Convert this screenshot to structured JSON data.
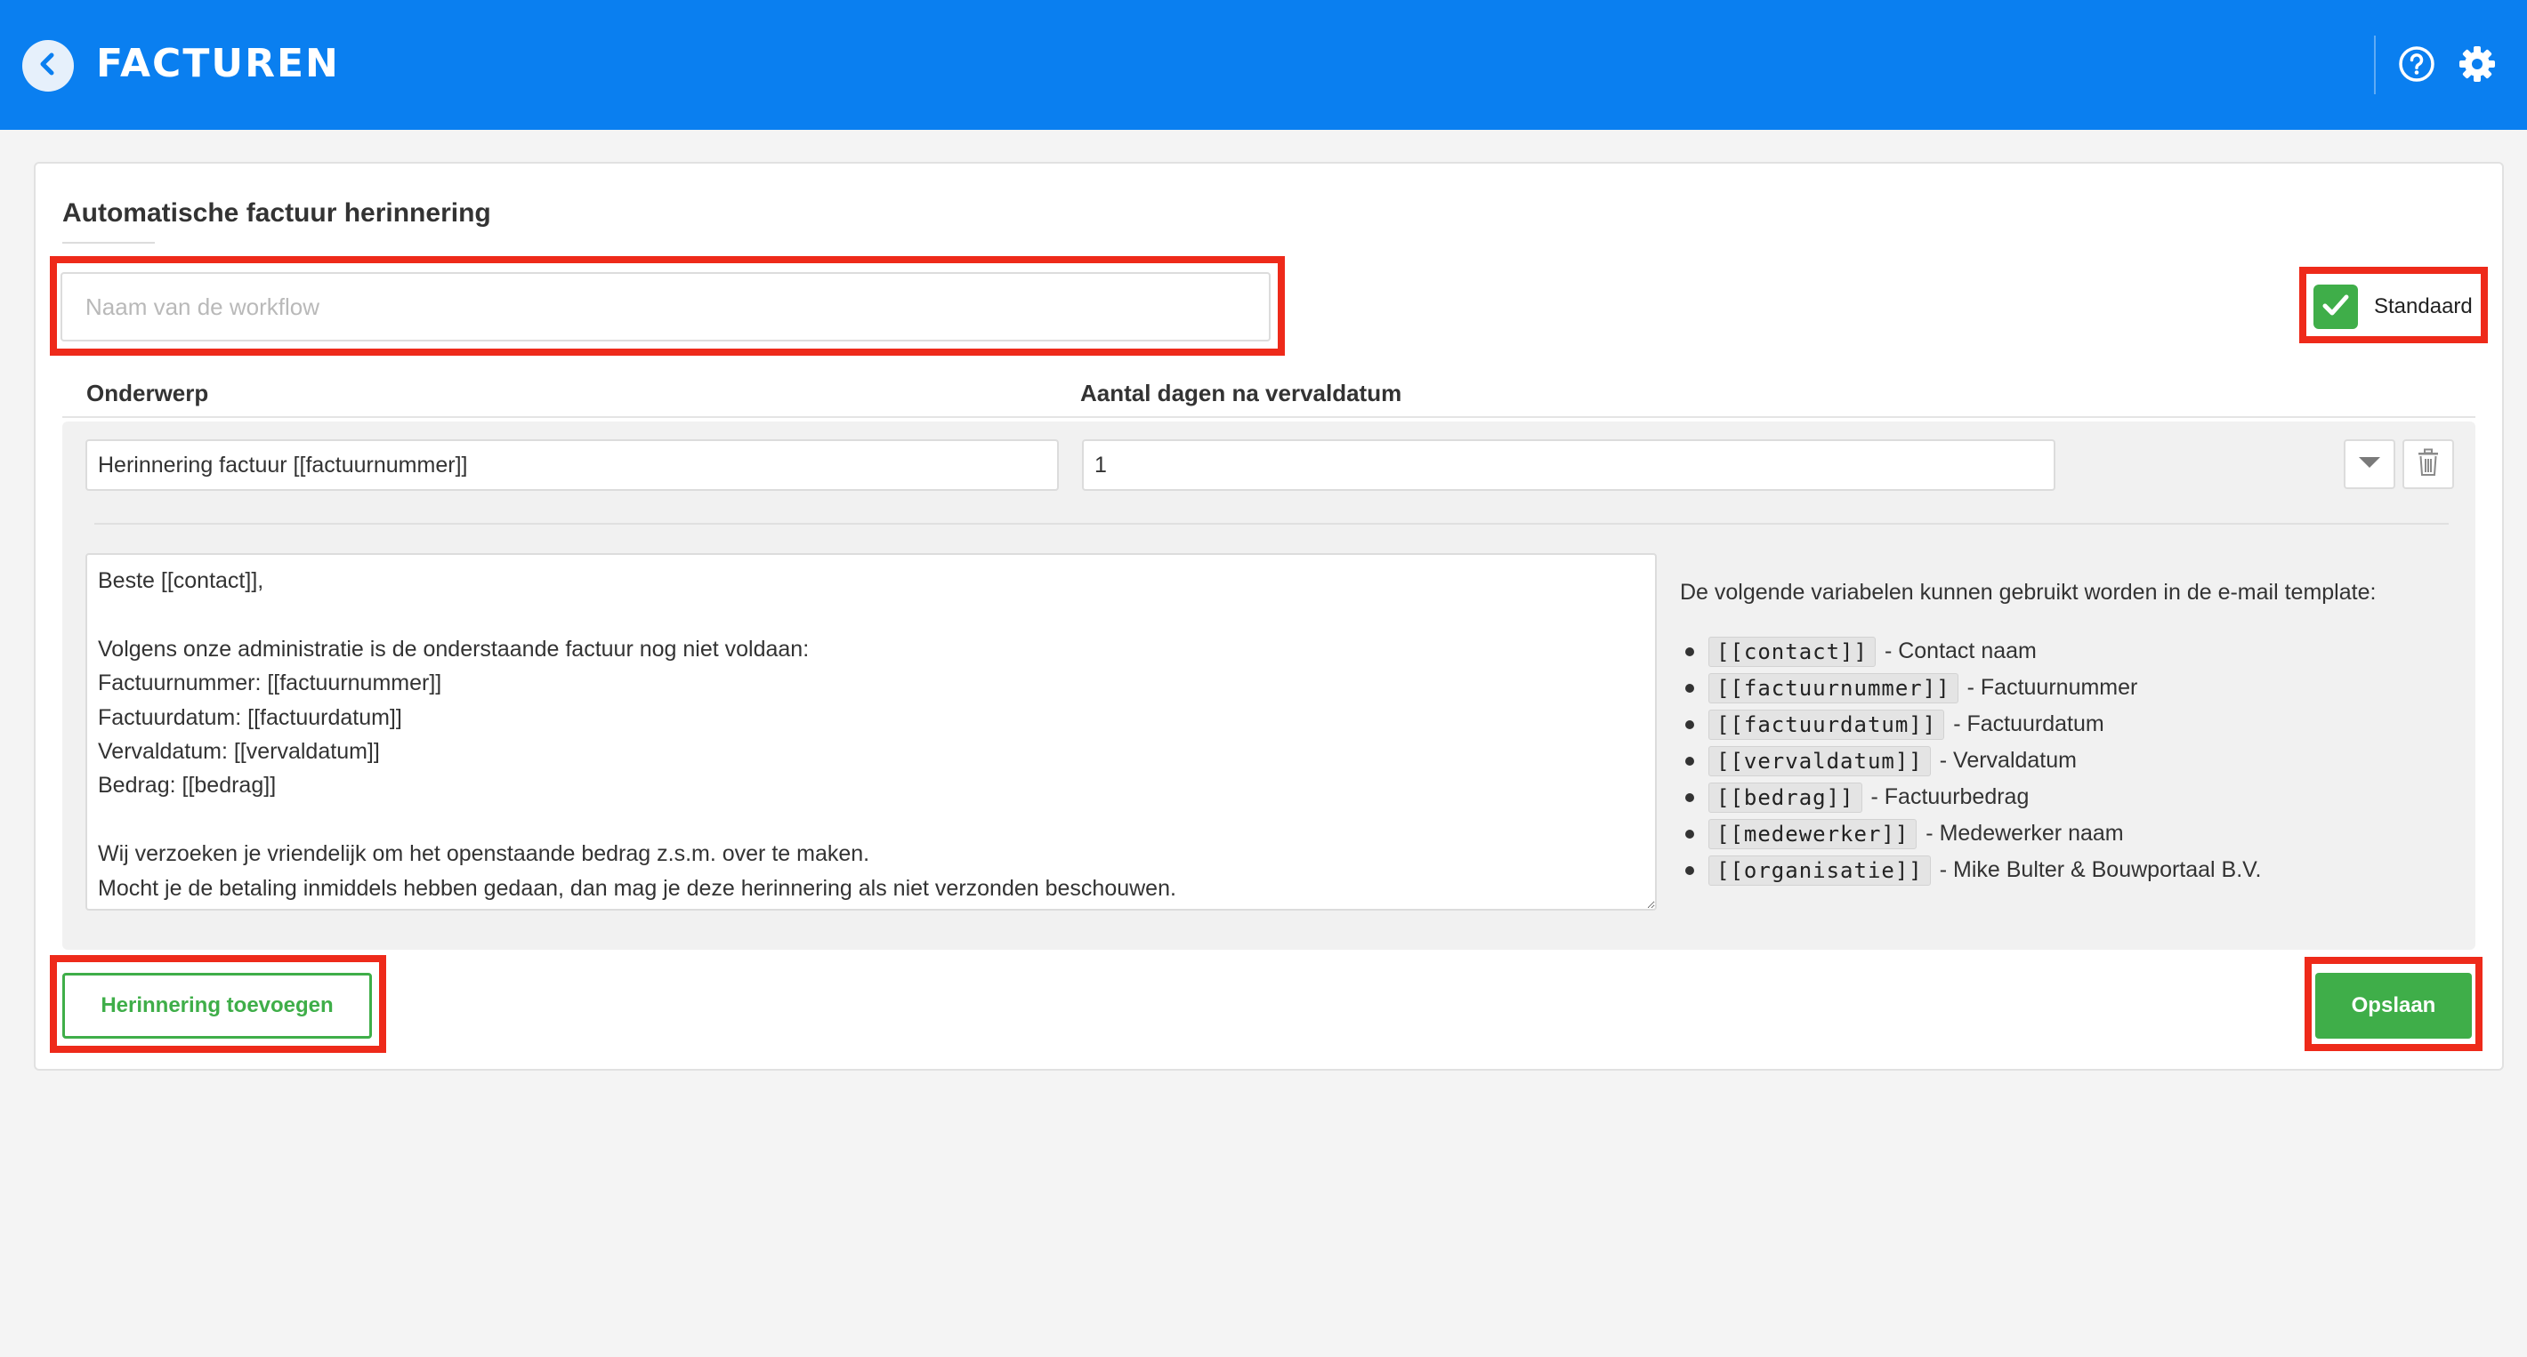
{
  "header": {
    "title": "FACTUREN",
    "back_icon": "chevron-left-icon",
    "help_icon": "help-circle-icon",
    "settings_icon": "gear-icon"
  },
  "workflow": {
    "heading": "Automatische factuur herinnering",
    "name_placeholder": "Naam van de workflow",
    "name_value": "",
    "default_label": "Standaard",
    "default_checked": true
  },
  "columns": {
    "subject": "Onderwerp",
    "days": "Aantal dagen na vervaldatum"
  },
  "reminder": {
    "subject": "Herinnering factuur [[factuurnummer]]",
    "days": "1",
    "body": "Beste [[contact]],\n\nVolgens onze administratie is de onderstaande factuur nog niet voldaan:\nFactuurnummer: [[factuurnummer]]\nFactuurdatum: [[factuurdatum]]\nVervaldatum: [[vervaldatum]]\nBedrag: [[bedrag]]\n\nWij verzoeken je vriendelijk om het openstaande bedrag z.s.m. over te maken.\nMocht je de betaling inmiddels hebben gedaan, dan mag je deze herinnering als niet verzonden beschouwen."
  },
  "variables": {
    "intro": "De volgende variabelen kunnen gebruikt worden in de e-mail template:",
    "items": [
      {
        "code": "[[contact]]",
        "desc": "- Contact naam"
      },
      {
        "code": "[[factuurnummer]]",
        "desc": "- Factuurnummer"
      },
      {
        "code": "[[factuurdatum]]",
        "desc": "- Factuurdatum"
      },
      {
        "code": "[[vervaldatum]]",
        "desc": "- Vervaldatum"
      },
      {
        "code": "[[bedrag]]",
        "desc": "- Factuurbedrag"
      },
      {
        "code": "[[medewerker]]",
        "desc": "- Medewerker naam"
      },
      {
        "code": "[[organisatie]]",
        "desc": "- Mike Bulter & Bouwportaal B.V."
      }
    ]
  },
  "actions": {
    "add_label": "Herinnering toevoegen",
    "save_label": "Opslaan"
  },
  "colors": {
    "header_blue": "#0a7ff0",
    "green": "#3fae49",
    "highlight_red": "#ee2a1a"
  }
}
